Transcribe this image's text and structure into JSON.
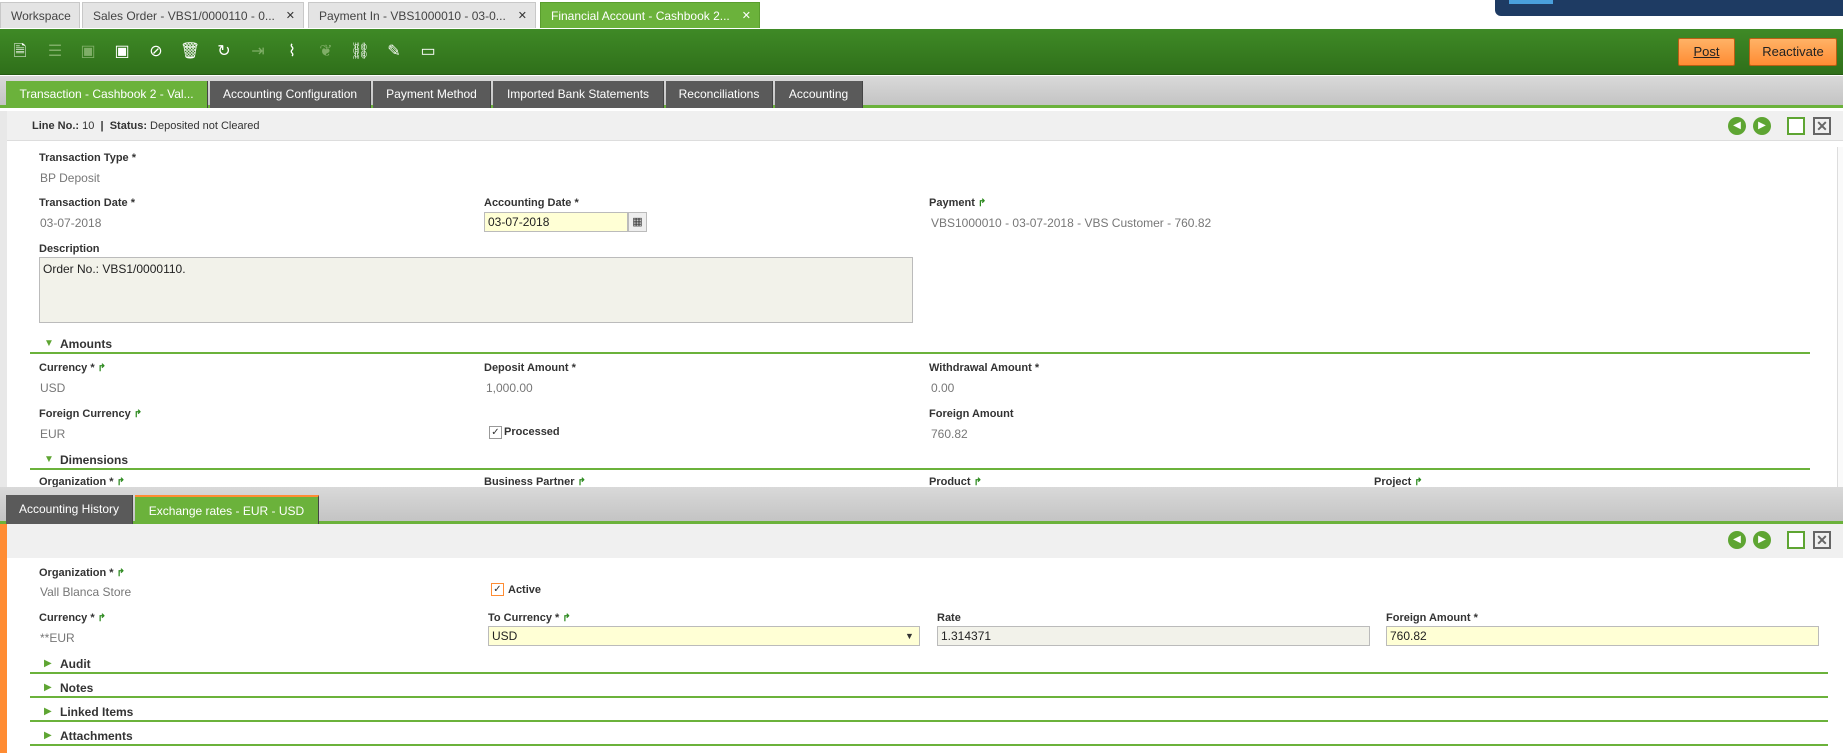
{
  "window_tabs": [
    {
      "label": "Workspace",
      "closable": false
    },
    {
      "label": "Sales Order - VBS1/0000110 - 0...",
      "closable": true
    },
    {
      "label": "Payment In - VBS1000010 - 03-0...",
      "closable": true
    },
    {
      "label": "Financial Account - Cashbook 2...",
      "closable": true
    }
  ],
  "toolbar": {
    "post_label": "Post",
    "reactivate_label": "Reactivate"
  },
  "top_tabs": [
    "Transaction - Cashbook 2 - Val...",
    "Accounting Configuration",
    "Payment Method",
    "Imported Bank Statements",
    "Reconciliations",
    "Accounting"
  ],
  "status": {
    "line_label": "Line No.:",
    "line_value": "10",
    "sep": "|",
    "status_label": "Status:",
    "status_value": "Deposited not Cleared"
  },
  "form": {
    "transaction_type_label": "Transaction Type *",
    "transaction_type": "BP Deposit",
    "transaction_date_label": "Transaction Date *",
    "transaction_date": "03-07-2018",
    "accounting_date_label": "Accounting Date *",
    "accounting_date": "03-07-2018",
    "payment_label": "Payment",
    "payment": "VBS1000010 - 03-07-2018 - VBS Customer - 760.82",
    "description_label": "Description",
    "description": "Order No.: VBS1/0000110."
  },
  "amounts": {
    "section": "Amounts",
    "currency_label": "Currency *",
    "currency": "USD",
    "deposit_label": "Deposit Amount *",
    "deposit": "1,000.00",
    "withdrawal_label": "Withdrawal Amount *",
    "withdrawal": "0.00",
    "foreign_currency_label": "Foreign Currency",
    "foreign_currency": "EUR",
    "processed_label": "Processed",
    "processed": true,
    "foreign_amount_label": "Foreign Amount",
    "foreign_amount": "760.82"
  },
  "dimensions": {
    "section": "Dimensions",
    "organization_label": "Organization *",
    "business_partner_label": "Business Partner",
    "product_label": "Product",
    "project_label": "Project"
  },
  "bottom_tabs": [
    "Accounting History",
    "Exchange rates - EUR - USD"
  ],
  "exchange": {
    "organization_label": "Organization *",
    "organization": "Vall Blanca Store",
    "active_label": "Active",
    "active": true,
    "currency_label": "Currency *",
    "currency": "**EUR",
    "to_currency_label": "To Currency *",
    "to_currency": "USD",
    "rate_label": "Rate",
    "rate": "1.314371",
    "foreign_amount_label": "Foreign Amount *",
    "foreign_amount": "760.82"
  },
  "collapsed_sections": [
    "Audit",
    "Notes",
    "Linked Items",
    "Attachments"
  ],
  "colors": {
    "accent_green": "#6bb23b",
    "toolbar_green": "#3f8a26",
    "action_orange": "#ff8c33"
  }
}
